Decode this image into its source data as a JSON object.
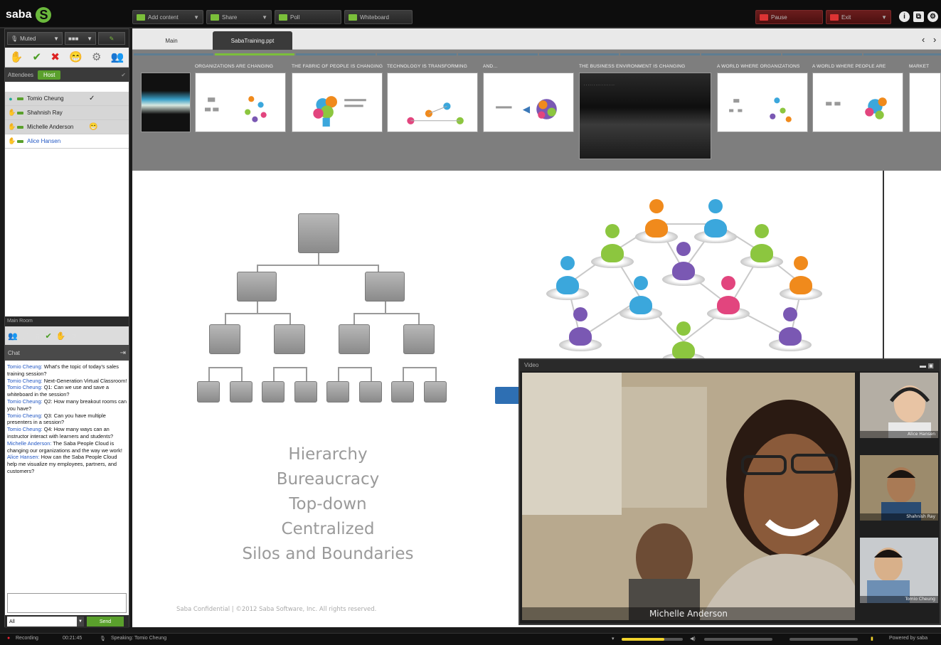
{
  "brand": {
    "name": "saba",
    "mark": "S"
  },
  "toolbar": {
    "add_content": "Add content",
    "share": "Share",
    "poll": "Poll",
    "whiteboard": "Whiteboard",
    "pause": "Pause",
    "exit": "Exit",
    "help_icon": "info-icon",
    "fullscreen_icon": "fullscreen-icon",
    "settings_icon": "gear-icon"
  },
  "left": {
    "mic_label": "Muted",
    "level_label": "■■■",
    "attendees_label": "Attendees",
    "attendees_pill": "Host",
    "attendees": [
      {
        "name": "Tomio Cheung",
        "status": "✓"
      },
      {
        "name": "Shahnish Ray",
        "status": ""
      },
      {
        "name": "Michelle Anderson",
        "status": "😁"
      },
      {
        "name": "Alice Hansen",
        "status": ""
      }
    ],
    "rooms_label": "Main Room",
    "chat_label": "Chat",
    "chat": [
      {
        "who": "Tomio Cheung:",
        "text": "What's the topic of today's sales training session?"
      },
      {
        "who": "Tomio Cheung:",
        "text": "Next-Generation Virtual Classroom!"
      },
      {
        "who": "Tomio Cheung:",
        "text": "Q1: Can we use and save a whiteboard in the session?"
      },
      {
        "who": "Tomio Cheung:",
        "text": "Q2: How many breakout rooms can you have?"
      },
      {
        "who": "Tomio Cheung:",
        "text": "Q3: Can you have multiple presenters in a session?"
      },
      {
        "who": "Tomio Cheung:",
        "text": "Q4: How many ways can an instructor interact with learners and students?"
      },
      {
        "who": "Michelle Anderson:",
        "text": "The Saba People Cloud is changing our organizations and the way we work!"
      },
      {
        "who": "Alice Hansen:",
        "text": "How can the Saba People Cloud help me visualize my employees, partners, and customers?"
      }
    ],
    "chat_target": "All",
    "send_label": "Send"
  },
  "tabs": [
    {
      "label": "Main"
    },
    {
      "label": "SabaTraining.ppt"
    }
  ],
  "thumb_titles": [
    "",
    "ORGANIZATIONS ARE CHANGING",
    "THE FABRIC OF PEOPLE IS CHANGING",
    "TECHNOLOGY IS TRANSFORMING",
    "AND...",
    "",
    "THE BUSINESS ENVIRONMENT IS CHANGING",
    "A WORLD WHERE ORGANIZATIONS",
    "A WORLD WHERE PEOPLE ARE",
    "MARKET"
  ],
  "slide": {
    "words": [
      "Hierarchy",
      "Bureaucracy",
      "Top-down",
      "Centralized",
      "Silos and Boundaries"
    ],
    "footer": "Saba Confidential | ©2012 Saba Software, Inc. All rights reserved."
  },
  "video": {
    "header": "Video",
    "main_name": "Michelle Anderson",
    "side": [
      {
        "name": "Alice Hansen"
      },
      {
        "name": "Shahnish Ray"
      },
      {
        "name": "Tomio Cheung"
      }
    ]
  },
  "status": {
    "recording": "Recording",
    "time": "00:21:45",
    "speaking": "Speaking: Tomio Cheung",
    "powered": "Powered by saba"
  },
  "colors": {
    "accent_green": "#5aa02c",
    "link_blue": "#2358c4",
    "person_colors": [
      "#f08a1c",
      "#3ba7dc",
      "#8cc63f",
      "#7a58b3",
      "#e2457e"
    ]
  }
}
